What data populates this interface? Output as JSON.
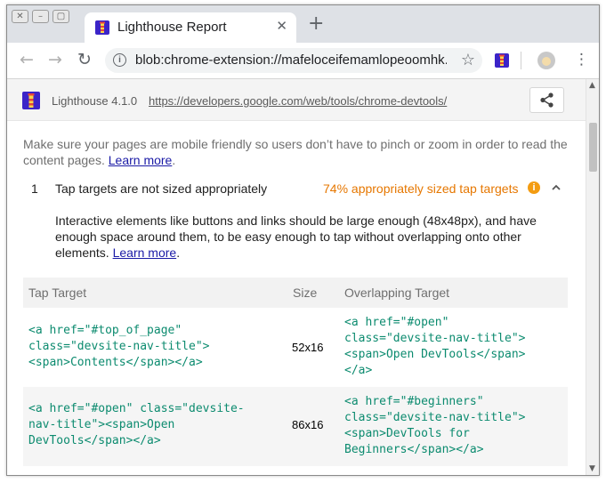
{
  "window": {
    "controls": {
      "close": "✕",
      "minimize": "–",
      "maximize": "▢"
    }
  },
  "tab": {
    "title": "Lighthouse Report",
    "close_symbol": "✕",
    "new_tab_symbol": "+"
  },
  "toolbar": {
    "back_symbol": "←",
    "forward_symbol": "→",
    "reload_symbol": "↻",
    "info_symbol": "i",
    "url": "blob:chrome-extension://mafeloceifemamlopeoomhk...",
    "star_symbol": "☆",
    "menu_symbol": "⋮"
  },
  "lighthouse": {
    "version": "Lighthouse 4.1.0",
    "url": "https://developers.google.com/web/tools/chrome-devtools/"
  },
  "category_description": {
    "text": "Make sure your pages are mobile friendly so users don’t have to pinch or zoom in order to read the content pages. ",
    "link": "Learn more",
    "suffix": "."
  },
  "audit": {
    "number": "1",
    "title": "Tap targets are not sized appropriately",
    "display_value": "74% appropriately sized tap targets",
    "warning_symbol": "i",
    "description": "Interactive elements like buttons and links should be large enough (48x48px), and have enough space around them, to be easy enough to tap without overlapping onto other elements. ",
    "description_link": "Learn more",
    "description_suffix": "."
  },
  "table": {
    "headers": [
      "Tap Target",
      "Size",
      "Overlapping Target"
    ],
    "rows": [
      {
        "target": "<a href=\"#top_of_page\"\nclass=\"devsite-nav-title\">\n<span>Contents</span></a>",
        "size": "52x16",
        "overlapping": "<a href=\"#open\"\nclass=\"devsite-nav-title\">\n<span>Open DevTools</span>\n</a>"
      },
      {
        "target": "<a href=\"#open\" class=\"devsite-\nnav-title\"><span>Open\nDevTools</span></a>",
        "size": "86x16",
        "overlapping": "<a href=\"#beginners\"\nclass=\"devsite-nav-title\">\n<span>DevTools for\nBeginners</span></a>"
      }
    ]
  },
  "scrollbar": {
    "up_symbol": "▲",
    "down_symbol": "▼"
  },
  "colors": {
    "accent_warning": "#e67700",
    "code_green": "#0c8b6f",
    "link_blue": "#1a1aa6"
  },
  "icons": {
    "tab_favicon": "lighthouse-icon",
    "extension": "lighthouse-icon",
    "share": "share-icon",
    "avatar": "avatar-icon"
  }
}
